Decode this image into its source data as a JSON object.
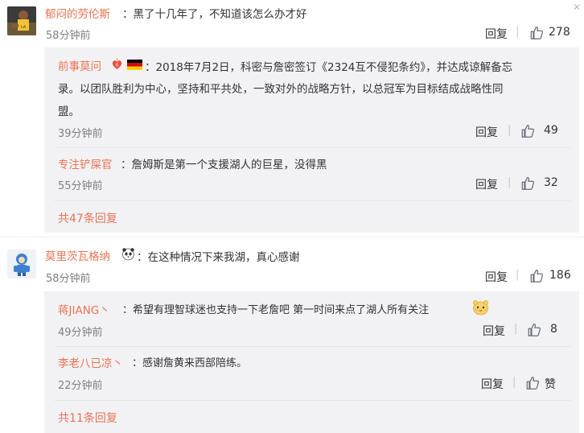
{
  "comments": [
    {
      "user": "郁闷的劳伦斯",
      "text": "：黑了十几年了，不知道该怎么办才好",
      "time": "58分钟前",
      "reply_label": "回复",
      "likes": "278",
      "replies": [
        {
          "user": "前事莫问",
          "text_line1": "：2018年7月2日，科密与詹密签订《2324互不侵犯条约》，并达成谅解备忘",
          "text_line2": "录。以团队胜利为中心，坚持和平共处，一致对外的战略方针，以总冠军为目标结成战略性同",
          "text_line3": "盟。",
          "time": "39分钟前",
          "reply_label": "回复",
          "likes": "49"
        },
        {
          "user": "专注铲屎官",
          "text": "：詹姆斯是第一个支援湖人的巨星，没得黑",
          "time": "55分钟前",
          "reply_label": "回复",
          "likes": "32"
        }
      ],
      "more_replies": "共47条回复"
    },
    {
      "user": "莫里茨瓦格纳",
      "text": "：在这种情况下来我湖，真心感谢",
      "time": "58分钟前",
      "reply_label": "回复",
      "likes": "186",
      "replies": [
        {
          "user": "蒋JIANG丶",
          "text": "：希望有理智球迷也支持一下老詹吧 第一时间来点了湖人所有关注",
          "time": "49分钟前",
          "reply_label": "回复",
          "likes": "8"
        },
        {
          "user": "李老八已凉丶",
          "text": "：感谢詹黄来西部陪练。",
          "time": "22分钟前",
          "reply_label": "回复",
          "likes": "赞"
        }
      ],
      "more_replies": "共11条回复"
    }
  ],
  "colors": {
    "username": "#eb7350",
    "text": "#333333",
    "meta": "#808080",
    "reply_bg": "#f2f2f5"
  },
  "icons": [
    "lakers-player-avatar",
    "flame-heart-badge",
    "germany-flag",
    "thumbs-up-icon",
    "panda-emoji",
    "hamster-emoji",
    "snow-avatar",
    "close-icon"
  ]
}
